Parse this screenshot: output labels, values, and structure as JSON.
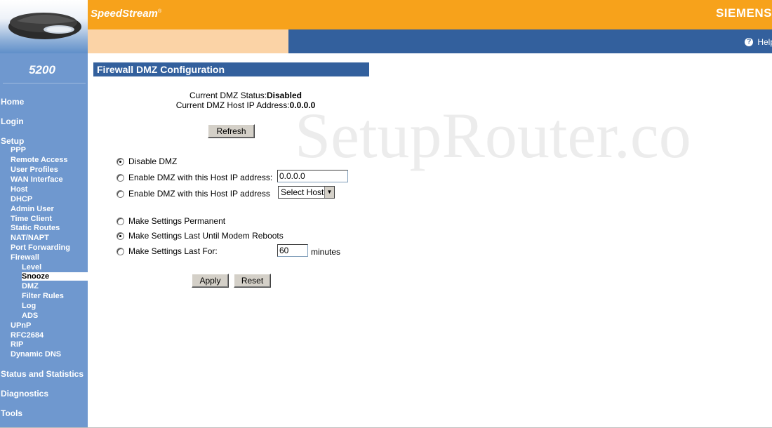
{
  "header": {
    "brand": "SpeedStream",
    "brand_mark": "®",
    "vendor": "SIEMENS",
    "help_label": "Help",
    "help_icon": "question-circle-icon"
  },
  "sidebar": {
    "model": "5200",
    "items": [
      {
        "label": "Home"
      },
      {
        "label": "Login"
      },
      {
        "label": "Setup"
      },
      {
        "label": "PPP"
      },
      {
        "label": "Remote Access"
      },
      {
        "label": "User Profiles"
      },
      {
        "label": "WAN Interface"
      },
      {
        "label": "Host"
      },
      {
        "label": "DHCP"
      },
      {
        "label": "Admin User"
      },
      {
        "label": "Time Client"
      },
      {
        "label": "Static Routes"
      },
      {
        "label": "NAT/NAPT"
      },
      {
        "label": "Port Forwarding"
      },
      {
        "label": "Firewall"
      },
      {
        "label": "Level"
      },
      {
        "label": "Snooze"
      },
      {
        "label": "DMZ"
      },
      {
        "label": "Filter Rules"
      },
      {
        "label": "Log"
      },
      {
        "label": "ADS"
      },
      {
        "label": "UPnP"
      },
      {
        "label": "RFC2684"
      },
      {
        "label": "RIP"
      },
      {
        "label": "Dynamic DNS"
      },
      {
        "label": "Status and Statistics"
      },
      {
        "label": "Diagnostics"
      },
      {
        "label": "Tools"
      }
    ]
  },
  "page": {
    "title": "Firewall DMZ Configuration",
    "watermark": "SetupRouter.co",
    "status_label": "Current DMZ Status:",
    "status_value": "Disabled",
    "host_label": "Current DMZ Host IP Address:",
    "host_value": "0.0.0.0",
    "refresh_label": "Refresh",
    "dmz_options": {
      "disable": "Disable DMZ",
      "enable_ip": "Enable DMZ with this Host IP address:",
      "enable_host": "Enable DMZ with this Host IP address",
      "ip_value": "0.0.0.0",
      "select_value": "Select Host",
      "selected": "disable"
    },
    "duration_options": {
      "permanent": "Make Settings Permanent",
      "until_reboot": "Make Settings Last Until Modem Reboots",
      "last_for": "Make Settings Last For:",
      "minutes_value": "60",
      "minutes_unit": "minutes",
      "selected": "until_reboot"
    },
    "apply_label": "Apply",
    "reset_label": "Reset"
  },
  "colors": {
    "orange": "#f7a21b",
    "navy": "#33609d",
    "sidebar": "#6f98cf",
    "peach": "#fbd3a6"
  }
}
